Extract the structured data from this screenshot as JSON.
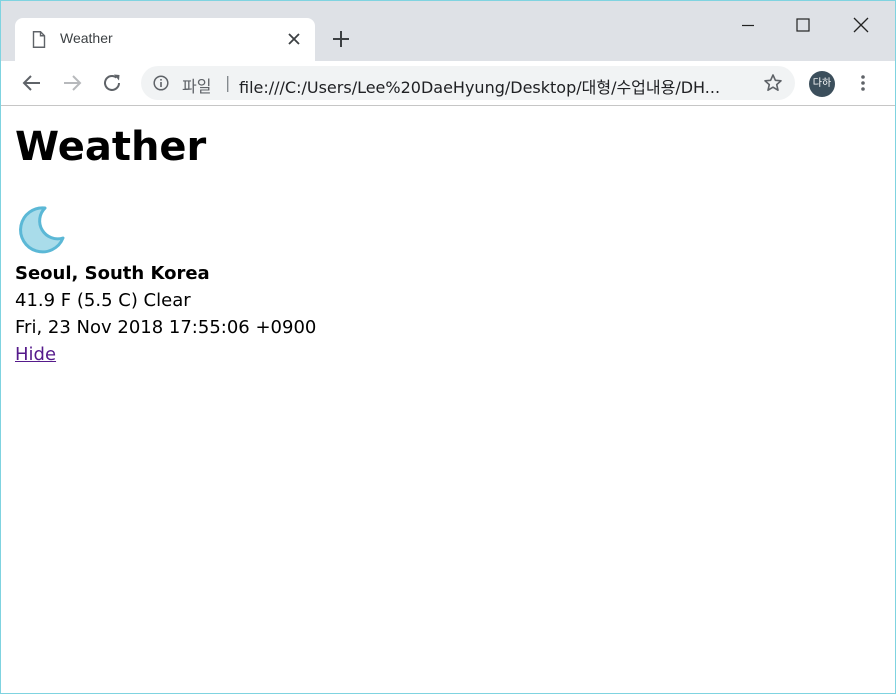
{
  "browser": {
    "tab_title": "Weather",
    "address_scheme_label": "파일",
    "address_separator": "|",
    "address_url": "file:///C:/Users/Lee%20DaeHyung/Desktop/대형/수업내용/DH...",
    "profile_initials": "다하",
    "profile_color": "#3c4f5c"
  },
  "page": {
    "title": "Weather",
    "weather_icon": "moon-icon",
    "location": "Seoul, South Korea",
    "conditions": "41.9 F (5.5 C) Clear",
    "timestamp": "Fri, 23 Nov 2018 17:55:06 +0900",
    "hide_link": "Hide",
    "link_color": "#551a8b"
  }
}
